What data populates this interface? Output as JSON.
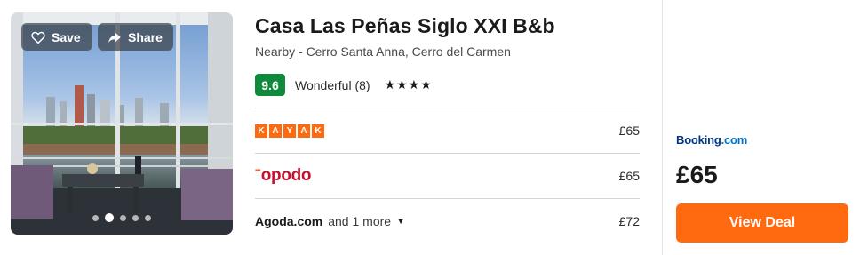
{
  "hotel": {
    "name": "Casa Las Peñas Siglo XXI B&b",
    "location": "Nearby - Cerro Santa Anna, Cerro del Carmen",
    "score": "9.6",
    "rating_text": "Wonderful (8)",
    "stars": "★★★★"
  },
  "photo": {
    "save_label": "Save",
    "share_label": "Share",
    "dots_total": 5,
    "dots_active_index": 1
  },
  "offers": [
    {
      "provider": "KAYAK",
      "price": "£65"
    },
    {
      "provider": "opodo",
      "price": "£65"
    },
    {
      "provider": "Agoda.com",
      "more": "and 1 more",
      "price": "£72"
    }
  ],
  "deal": {
    "provider_name": "Booking",
    "provider_suffix": ".com",
    "price": "£65",
    "button_label": "View Deal"
  },
  "colors": {
    "accent": "#ff690f",
    "score_bg": "#0f8a3c",
    "booking_blue": "#003580",
    "opodo_red": "#c8102e"
  }
}
